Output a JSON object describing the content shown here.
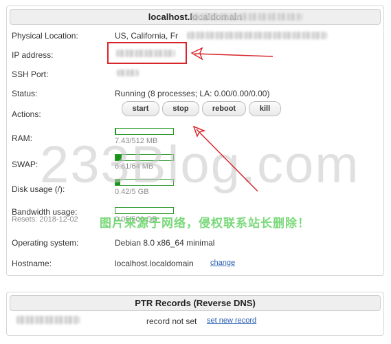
{
  "server": {
    "title": "localhost.localdomain",
    "fields": {
      "physical_location_label": "Physical Location:",
      "physical_location_value": "US, California, Fr",
      "ip_label": "IP address:",
      "ssh_label": "SSH Port:",
      "status_label": "Status:",
      "status_value": "Running (8 processes; LA: 0.00/0.00/0.00)",
      "actions_label": "Actions:",
      "ram_label": "RAM:",
      "ram_value": "7.43/512 MB",
      "ram_fraction": 0.0145,
      "swap_label": "SWAP:",
      "swap_value": "6.61/64 MB",
      "swap_fraction": 0.103,
      "disk_label": "Disk usage (/):",
      "disk_value": "0.42/5 GB",
      "disk_fraction": 0.084,
      "bandwidth_label": "Bandwidth usage:",
      "bandwidth_value": "0.05/500 GB",
      "bandwidth_fraction": 0.0001,
      "resets_label": "Resets: 2018-12-02",
      "os_label": "Operating system:",
      "os_value": "Debian 8.0 x86_64 minimal",
      "hostname_label": "Hostname:",
      "hostname_value": "localhost.localdomain",
      "change_link": "change"
    },
    "actions": {
      "start": "start",
      "stop": "stop",
      "reboot": "reboot",
      "kill": "kill"
    }
  },
  "ptr": {
    "title": "PTR Records (Reverse DNS)",
    "record_status": "record not set",
    "set_link": "set new record"
  },
  "watermark": {
    "main": "233Blog.com",
    "notice": "图片来源于网络，侵权联系站长删除！"
  },
  "colors": {
    "bar_fill": "#179417",
    "link": "#2a5db0",
    "annotation": "#d7262b"
  }
}
